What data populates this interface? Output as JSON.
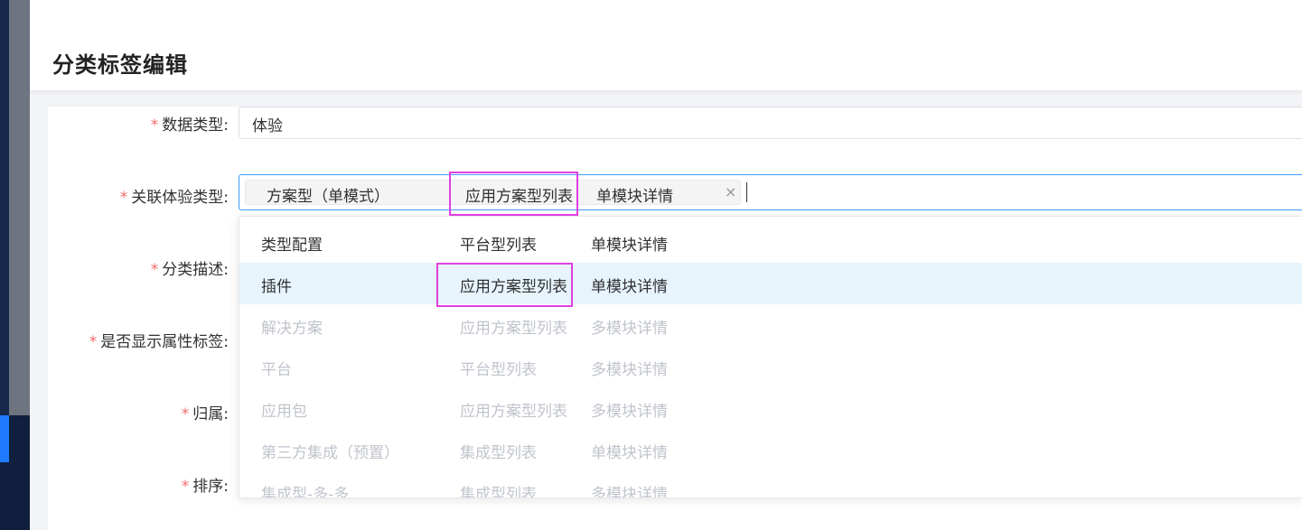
{
  "page": {
    "title": "分类标签编辑"
  },
  "form": {
    "data_type": {
      "label": "数据类型:",
      "value": "体验"
    },
    "experience_type": {
      "label": "关联体验类型:",
      "tag": {
        "name": "方案型（单模式）",
        "list": "应用方案型列表",
        "detail": "单模块详情",
        "close": "×"
      }
    },
    "category_desc": {
      "label": "分类描述:"
    },
    "show_attr_tag": {
      "label": "是否显示属性标签:"
    },
    "belong": {
      "label": "归属:"
    },
    "sort": {
      "label": "排序:"
    }
  },
  "dropdown": {
    "options": [
      {
        "name": "类型配置",
        "list": "平台型列表",
        "detail": "单模块详情",
        "state": "enabled"
      },
      {
        "name": "插件",
        "list": "应用方案型列表",
        "detail": "单模块详情",
        "state": "hover"
      },
      {
        "name": "解决方案",
        "list": "应用方案型列表",
        "detail": "多模块详情",
        "state": "disabled"
      },
      {
        "name": "平台",
        "list": "平台型列表",
        "detail": "多模块详情",
        "state": "disabled"
      },
      {
        "name": "应用包",
        "list": "应用方案型列表",
        "detail": "多模块详情",
        "state": "disabled"
      },
      {
        "name": "第三方集成（预置）",
        "list": "集成型列表",
        "detail": "单模块详情",
        "state": "disabled"
      },
      {
        "name": "集成型-多-多",
        "list": "集成型列表",
        "detail": "多模块详情",
        "state": "disabled"
      }
    ]
  },
  "colors": {
    "required_star": "#f56c6c",
    "focus_border": "#409eff",
    "hover_bg": "#e7f4fc",
    "highlight": "#e040e0"
  }
}
